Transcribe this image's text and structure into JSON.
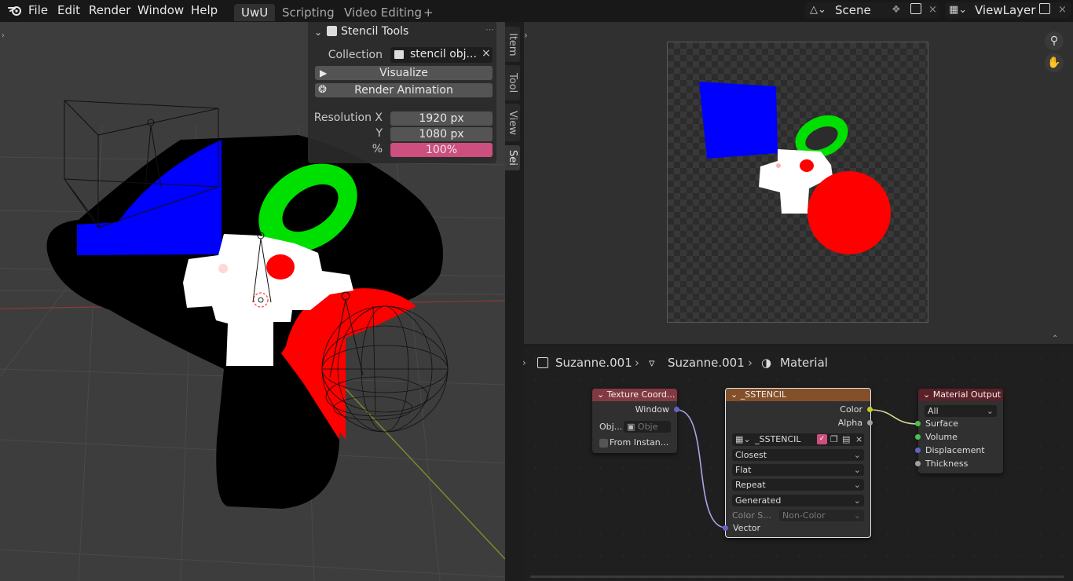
{
  "menu": {
    "file": "File",
    "edit": "Edit",
    "render": "Render",
    "window": "Window",
    "help": "Help"
  },
  "workspaces": [
    "UwU",
    "Scripting",
    "Video Editing",
    "+"
  ],
  "scene": {
    "name": "Scene"
  },
  "view_layer": {
    "name": "ViewLayer"
  },
  "stencil_panel": {
    "title": "Stencil Tools",
    "collection_label": "Collection",
    "collection_value": "stencil obj...",
    "visualize_label": "Visualize",
    "render_animation_label": "Render Animation",
    "resolution_x_label": "Resolution X",
    "resolution_x": "1920 px",
    "resolution_y_label": "Y",
    "resolution_y": "1080 px",
    "percent_label": "%",
    "percent_value": "100%"
  },
  "sidebar_tabs": [
    "Item",
    "Tool",
    "View",
    "Sei"
  ],
  "breadcrumb": {
    "object": "Suzanne.001",
    "mesh": "Suzanne.001",
    "material": "Material"
  },
  "nodes": {
    "texcoord": {
      "title": "Texture Coord...",
      "output_window": "Window",
      "object_label": "Obj...",
      "object_placeholder": "Obje",
      "from_instancer": "From Instan..."
    },
    "image": {
      "title": "_SSTENCIL",
      "output_color": "Color",
      "output_alpha": "Alpha",
      "image_name": "_SSTENCIL",
      "interpolation": "Closest",
      "projection": "Flat",
      "extension": "Repeat",
      "source": "Generated",
      "colorspace_label": "Color S...",
      "colorspace_value": "Non-Color",
      "input_vector": "Vector"
    },
    "output": {
      "title": "Material Output",
      "target": "All",
      "surface": "Surface",
      "volume": "Volume",
      "displacement": "Displacement",
      "thickness": "Thickness"
    }
  },
  "colors": {
    "accent_pink": "#cc4f7f",
    "image_node_header": "#83502a",
    "output_node_header": "#5a2128",
    "texcoord_header": "#833942",
    "socket_yellow": "#c7c729",
    "socket_purple": "#6363c7",
    "socket_green": "#4ac24a",
    "socket_grey": "#a1a1a1"
  }
}
